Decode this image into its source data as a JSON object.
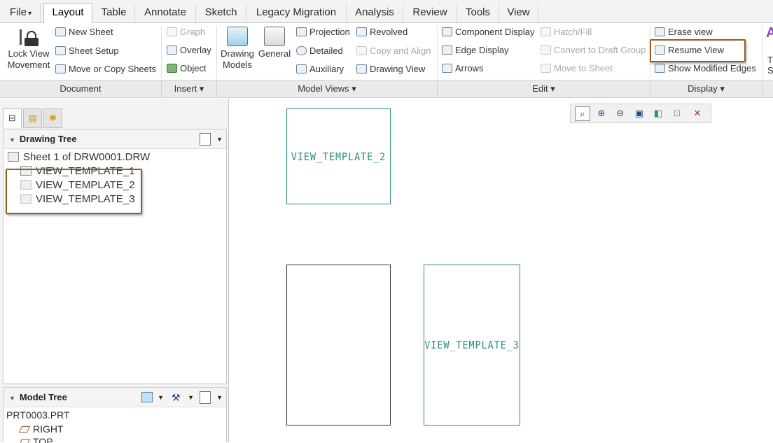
{
  "menu": {
    "tabs": [
      "File",
      "Layout",
      "Table",
      "Annotate",
      "Sketch",
      "Legacy Migration",
      "Analysis",
      "Review",
      "Tools",
      "View"
    ],
    "file_arrow": "▾"
  },
  "ribbon": {
    "lock_view_1": "Lock View",
    "lock_view_2": "Movement",
    "new_sheet": "New Sheet",
    "sheet_setup": "Sheet Setup",
    "move_copy": "Move or Copy Sheets",
    "graph": "Graph",
    "overlay": "Overlay",
    "object": "Object",
    "drawing_models_1": "Drawing",
    "drawing_models_2": "Models",
    "general": "General",
    "projection": "Projection",
    "detailed": "Detailed",
    "auxiliary": "Auxiliary",
    "revolved": "Revolved",
    "copy_align": "Copy and Align",
    "drawing_view": "Drawing View",
    "component_display": "Component Display",
    "edge_display": "Edge Display",
    "arrows": "Arrows",
    "hatch_fill": "Hatch/Fill",
    "convert_draft": "Convert to Draft Group",
    "move_to_sheet": "Move to Sheet",
    "erase_view": "Erase view",
    "resume_view": "Resume View",
    "show_modified_edges": "Show Modified Edges",
    "cut_t": "T",
    "cut_s": "S"
  },
  "groups": {
    "document": "Document",
    "insert": "Insert ▾",
    "model_views": "Model Views ▾",
    "edit": "Edit ▾",
    "display": "Display ▾"
  },
  "drawing_tree": {
    "title": "Drawing Tree",
    "sheet": "Sheet 1 of DRW0001.DRW",
    "items": [
      "VIEW_TEMPLATE_1",
      "VIEW_TEMPLATE_2",
      "VIEW_TEMPLATE_3"
    ]
  },
  "model_tree": {
    "title": "Model Tree",
    "root": "PRT0003.PRT",
    "items": [
      "RIGHT",
      "TOP"
    ]
  },
  "canvas": {
    "view_label_2": "VIEW_TEMPLATE_2",
    "view_label_3": "VIEW_TEMPLATE_3",
    "view_color": "#2a8f7b"
  },
  "highlight_color": "#9a5a1c"
}
